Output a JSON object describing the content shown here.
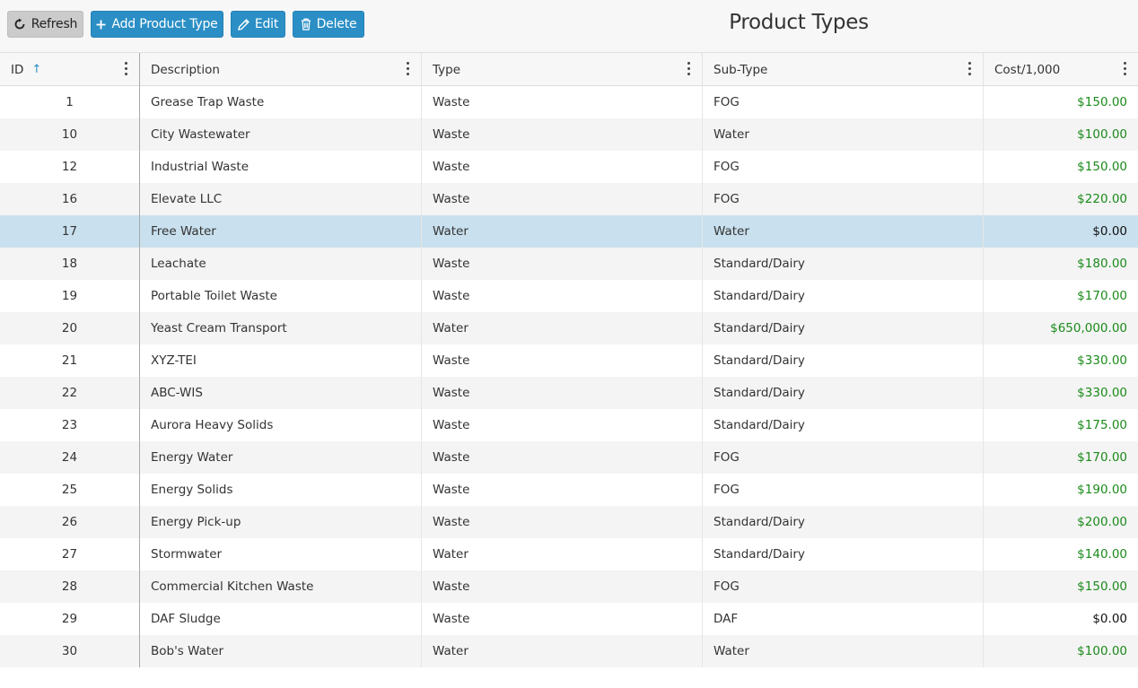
{
  "toolbar": {
    "refresh_label": "Refresh",
    "add_label": "Add Product Type",
    "edit_label": "Edit",
    "delete_label": "Delete",
    "title": "Product Types"
  },
  "columns": {
    "id": "ID",
    "description": "Description",
    "type": "Type",
    "subtype": "Sub-Type",
    "cost": "Cost/1,000",
    "sort_indicator": "↑"
  },
  "colors": {
    "accent": "#2b8fc6",
    "selected_row": "#c9e0ee",
    "positive_cost": "#1a8a1a"
  },
  "selected_id": "17",
  "rows": [
    {
      "id": "1",
      "description": "Grease Trap Waste",
      "type": "Waste",
      "subtype": "FOG",
      "cost": "$150.00"
    },
    {
      "id": "10",
      "description": "City Wastewater",
      "type": "Waste",
      "subtype": "Water",
      "cost": "$100.00"
    },
    {
      "id": "12",
      "description": "Industrial Waste",
      "type": "Waste",
      "subtype": "FOG",
      "cost": "$150.00"
    },
    {
      "id": "16",
      "description": "Elevate LLC",
      "type": "Waste",
      "subtype": "FOG",
      "cost": "$220.00"
    },
    {
      "id": "17",
      "description": "Free Water",
      "type": "Water",
      "subtype": "Water",
      "cost": "$0.00"
    },
    {
      "id": "18",
      "description": "Leachate",
      "type": "Waste",
      "subtype": "Standard/Dairy",
      "cost": "$180.00"
    },
    {
      "id": "19",
      "description": "Portable Toilet Waste",
      "type": "Waste",
      "subtype": "Standard/Dairy",
      "cost": "$170.00"
    },
    {
      "id": "20",
      "description": "Yeast Cream Transport",
      "type": "Water",
      "subtype": "Standard/Dairy",
      "cost": "$650,000.00"
    },
    {
      "id": "21",
      "description": "XYZ-TEI",
      "type": "Waste",
      "subtype": "Standard/Dairy",
      "cost": "$330.00"
    },
    {
      "id": "22",
      "description": "ABC-WIS",
      "type": "Waste",
      "subtype": "Standard/Dairy",
      "cost": "$330.00"
    },
    {
      "id": "23",
      "description": "Aurora Heavy Solids",
      "type": "Waste",
      "subtype": "Standard/Dairy",
      "cost": "$175.00"
    },
    {
      "id": "24",
      "description": "Energy Water",
      "type": "Waste",
      "subtype": "FOG",
      "cost": "$170.00"
    },
    {
      "id": "25",
      "description": "Energy Solids",
      "type": "Waste",
      "subtype": "FOG",
      "cost": "$190.00"
    },
    {
      "id": "26",
      "description": "Energy Pick-up",
      "type": "Waste",
      "subtype": "Standard/Dairy",
      "cost": "$200.00"
    },
    {
      "id": "27",
      "description": "Stormwater",
      "type": "Water",
      "subtype": "Standard/Dairy",
      "cost": "$140.00"
    },
    {
      "id": "28",
      "description": "Commercial Kitchen Waste",
      "type": "Waste",
      "subtype": "FOG",
      "cost": "$150.00"
    },
    {
      "id": "29",
      "description": "DAF Sludge",
      "type": "Waste",
      "subtype": "DAF",
      "cost": "$0.00"
    },
    {
      "id": "30",
      "description": "Bob's Water",
      "type": "Water",
      "subtype": "Water",
      "cost": "$100.00"
    }
  ]
}
